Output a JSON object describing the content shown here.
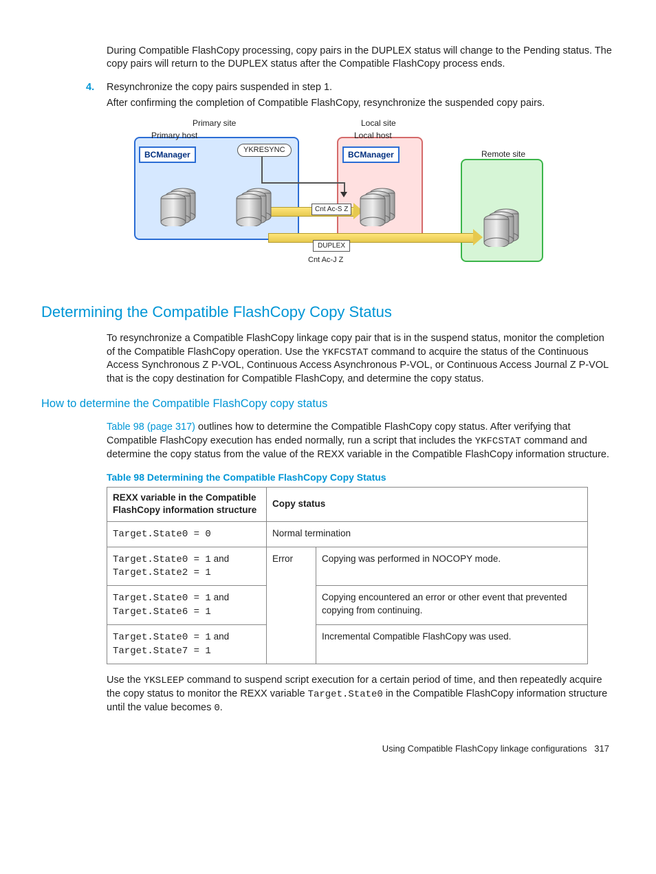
{
  "para1": "During Compatible FlashCopy processing, copy pairs in the DUPLEX status will change to the Pending status. The copy pairs will return to the DUPLEX status after the Compatible FlashCopy process ends.",
  "step4_num": "4.",
  "step4_line1": "Resynchronize the copy pairs suspended in step 1.",
  "step4_line2": "After confirming the completion of Compatible FlashCopy, resynchronize the suspended copy pairs.",
  "diagram": {
    "primary_site": "Primary site",
    "local_site": "Local site",
    "remote_site": "Remote site",
    "primary_host": "Primary host",
    "local_host": "Local host",
    "bcmanager": "BCManager",
    "ykresync": "YKRESYNC",
    "cnt_ac_s": "Cnt Ac-S Z",
    "duplex": "DUPLEX",
    "cnt_ac_j": "Cnt Ac-J Z"
  },
  "h2": "Determining the Compatible FlashCopy Copy Status",
  "para2a": "To resynchronize a Compatible FlashCopy linkage copy pair that is in the suspend status, monitor the completion of the Compatible FlashCopy operation. Use the ",
  "para2_code": "YKFCSTAT",
  "para2b": " command to acquire the status of the Continuous Access Synchronous Z P-VOL, Continuous Access Asynchronous P-VOL, or Continuous Access Journal Z P-VOL that is the copy destination for Compatible FlashCopy, and determine the copy status.",
  "h3": "How to determine the Compatible FlashCopy copy status",
  "xref": "Table 98 (page 317)",
  "para3a_after": " outlines how to determine the Compatible FlashCopy copy status. After verifying that Compatible FlashCopy execution has ended normally, run a script that includes the ",
  "para3_code": "YKFCSTAT",
  "para3b": " command and determine the copy status from the value of the REXX variable in the Compatible FlashCopy information structure.",
  "table_caption": "Table 98 Determining the Compatible FlashCopy Copy Status",
  "table": {
    "head_rexx": "REXX variable in the Compatible FlashCopy information structure",
    "head_status": "Copy status",
    "r1_var": "Target.State0 = 0",
    "r1_status": "Normal termination",
    "r2_var_a": "Target.State0 = 1",
    "r2_and": " and ",
    "r2_var_b": "Target.State2 = 1",
    "r2_status": "Error",
    "r2_desc": "Copying was performed in NOCOPY mode.",
    "r3_var_a": "Target.State0 = 1",
    "r3_var_b": "Target.State6 = 1",
    "r3_desc": "Copying encountered an error or other event that prevented copying from continuing.",
    "r4_var_a": "Target.State0 = 1",
    "r4_var_b": "Target.State7 = 1",
    "r4_desc": "Incremental Compatible FlashCopy was used."
  },
  "para4a": "Use the ",
  "para4_code1": "YKSLEEP",
  "para4b": " command to suspend script execution for a certain period of time, and then repeatedly acquire the copy status to monitor the REXX variable ",
  "para4_code2": "Target.State0",
  "para4c": " in the Compatible FlashCopy information structure until the value becomes ",
  "para4_code3": "0",
  "para4d": ".",
  "footer_text": "Using Compatible FlashCopy linkage configurations",
  "footer_page": "317"
}
